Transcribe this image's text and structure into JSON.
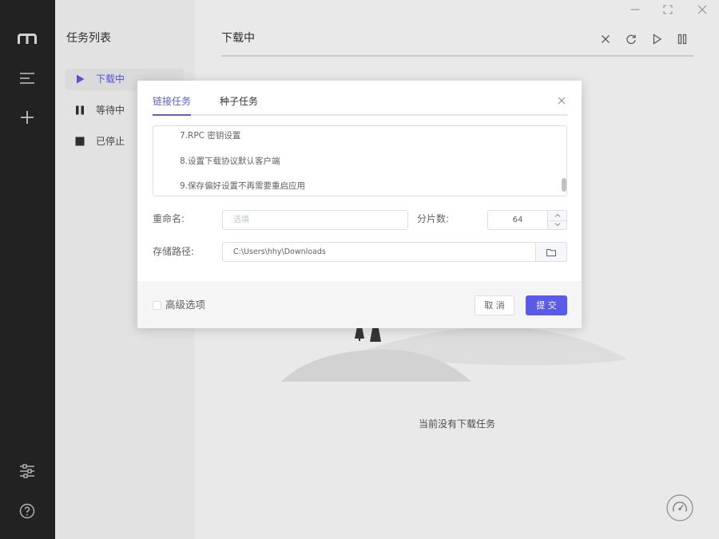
{
  "window_controls": {
    "minimize_icon": "minimize-icon",
    "maximize_icon": "maximize-icon",
    "close_icon": "close-icon"
  },
  "sidebar": {
    "logo_icon": "motrix-logo-icon",
    "menu_icon": "menu-icon",
    "add_icon": "plus-icon",
    "preferences_icon": "sliders-icon",
    "help_icon": "help-circle-icon"
  },
  "task_list": {
    "title": "任务列表",
    "items": [
      {
        "label": "下载中",
        "icon": "play-icon",
        "active": true
      },
      {
        "label": "等待中",
        "icon": "pause-icon",
        "active": false
      },
      {
        "label": "已停止",
        "icon": "stop-icon",
        "active": false
      }
    ]
  },
  "main": {
    "title": "下载中",
    "actions": [
      {
        "icon": "close-icon"
      },
      {
        "icon": "refresh-icon"
      },
      {
        "icon": "play-icon"
      },
      {
        "icon": "pause-icon"
      }
    ],
    "empty_text": "当前没有下载任务",
    "speedometer_icon": "speedometer-icon"
  },
  "dialog": {
    "tabs": [
      {
        "label": "链接任务",
        "active": true
      },
      {
        "label": "种子任务",
        "active": false
      }
    ],
    "close_icon": "close-icon",
    "uri_lines": [
      "7.RPC 密钥设置",
      "8.设置下载协议默认客户端",
      "9.保存偏好设置不再需要重启应用"
    ],
    "rename": {
      "label": "重命名:",
      "placeholder": "选填"
    },
    "split": {
      "label": "分片数:",
      "value": "64",
      "increase_icon": "chevron-up-icon",
      "decrease_icon": "chevron-down-icon"
    },
    "dir": {
      "label": "存储路径:",
      "value": "C:\\Users\\hhy\\Downloads",
      "folder_icon": "folder-icon"
    },
    "advanced": {
      "label": "高级选项",
      "checked": false
    },
    "cancel_label": "取 消",
    "submit_label": "提 交"
  },
  "colors": {
    "accent": "#5b5bea",
    "sidebar_bg": "#262626",
    "dialog_footer_bg": "#f5f5f5"
  }
}
